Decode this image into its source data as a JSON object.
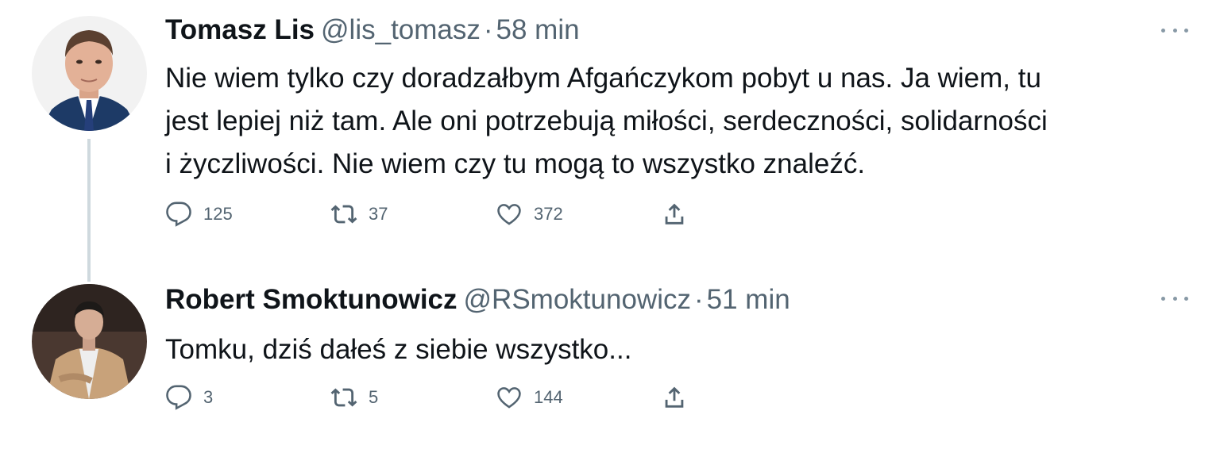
{
  "tweets": [
    {
      "name": "Tomasz Lis",
      "handle": "@lis_tomasz",
      "separator": "·",
      "time": "58 min",
      "text_lines": [
        "Nie wiem tylko czy doradzałbym Afgańczykom pobyt u nas. Ja wiem, tu",
        "jest lepiej niż tam. Ale  oni potrzebują miłości, serdeczności, solidarności",
        "i życzliwości. Nie wiem czy tu mogą to wszystko znaleźć."
      ],
      "replies": "125",
      "retweets": "37",
      "likes": "372",
      "avatar": "avatar-photo-man-suit"
    },
    {
      "name": "Robert Smoktunowicz",
      "handle": "@RSmoktunowicz",
      "separator": "·",
      "time": "51 min",
      "text_lines": [
        "Tomku, dziś dałeś z siebie wszystko..."
      ],
      "replies": "3",
      "retweets": "5",
      "likes": "144",
      "avatar": "avatar-photo-man-jacket"
    }
  ],
  "icons": {
    "reply": "reply-icon",
    "retweet": "retweet-icon",
    "like": "like-icon",
    "share": "share-icon",
    "more": "more-options-icon"
  },
  "colors": {
    "text": "#0f1419",
    "secondary": "#536471",
    "thread_line": "#cfd9de"
  }
}
